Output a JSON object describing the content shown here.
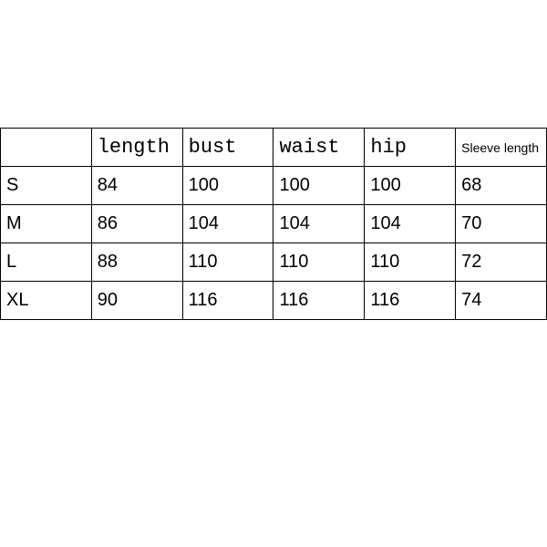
{
  "chart_data": {
    "type": "table",
    "headers": [
      "",
      "length",
      "bust",
      "waist",
      "hip",
      "Sleeve length"
    ],
    "rows": [
      {
        "size": "S",
        "length": "84",
        "bust": "100",
        "waist": "100",
        "hip": "100",
        "sleeve": "68"
      },
      {
        "size": "M",
        "length": "86",
        "bust": "104",
        "waist": "104",
        "hip": "104",
        "sleeve": "70"
      },
      {
        "size": "L",
        "length": "88",
        "bust": "110",
        "waist": "110",
        "hip": "110",
        "sleeve": "72"
      },
      {
        "size": "XL",
        "length": "90",
        "bust": "116",
        "waist": "116",
        "hip": "116",
        "sleeve": "74"
      }
    ]
  }
}
